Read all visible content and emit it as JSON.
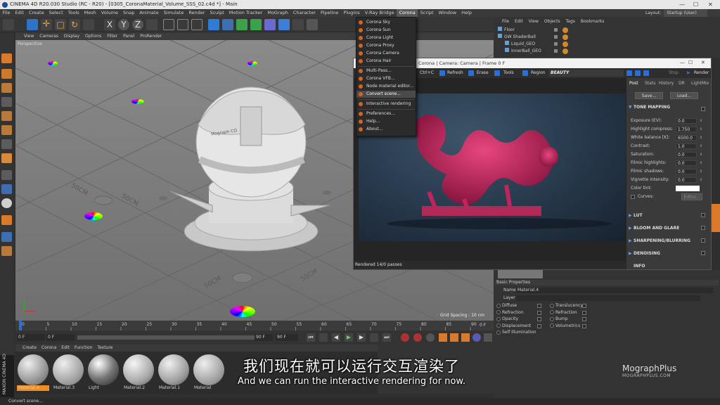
{
  "window": {
    "title": "CINEMA 4D R20.030 Studio (RC - R20) - [0305_CoronaMaterial_Volume_SSS_02.c4d *] - Main",
    "minimize": "—",
    "maximize": "☐",
    "close": "✕"
  },
  "menubar": {
    "items": [
      "File",
      "Edit",
      "Create",
      "Select",
      "Tools",
      "Mesh",
      "Volume",
      "Snap",
      "Animate",
      "Simulate",
      "Render",
      "Sculpt",
      "Motion Tracker",
      "MoGraph",
      "Character",
      "Pipeline",
      "Plugins",
      "V-Ray Bridge",
      "Corona",
      "Script",
      "Window",
      "Help"
    ],
    "active": "Corona",
    "layout_label": "Layout:",
    "layout_value": "Startup (User)"
  },
  "corona_menu": {
    "items": [
      {
        "label": "Corona Sky"
      },
      {
        "label": "Corona Sun"
      },
      {
        "label": "Corona Light"
      },
      {
        "label": "Corona Proxy"
      },
      {
        "label": "Corona Camera"
      },
      {
        "label": "Corona Hair"
      },
      {
        "label": "Multi-Pass..."
      },
      {
        "label": "Corona VFB..."
      },
      {
        "label": "Node material editor..."
      },
      {
        "label": "Convert scene..."
      },
      {
        "label": "Interactive rendering"
      },
      {
        "label": "Preferences..."
      },
      {
        "label": "Help..."
      },
      {
        "label": "About..."
      }
    ],
    "highlighted": "Convert scene..."
  },
  "viewport": {
    "menu": [
      "View",
      "Cameras",
      "Display",
      "Options",
      "Filter",
      "Panel",
      "ProRender"
    ],
    "label": "Perspective",
    "grid_spacing": "Grid Spacing : 10 cm",
    "floor_labels": [
      "50CM",
      "50CM",
      "50CM",
      "50CM"
    ],
    "sphere_text": "Mograph CO"
  },
  "timeline": {
    "ticks": [
      "0",
      "5",
      "10",
      "15",
      "20",
      "25",
      "30",
      "35",
      "40",
      "45",
      "50",
      "55",
      "60",
      "65",
      "70",
      "75",
      "80",
      "85",
      "90"
    ],
    "end_label": "0 F",
    "start_field": "0 F",
    "min_field": "0 F",
    "max_field": "90 F",
    "end_field": "90 F"
  },
  "object_manager": {
    "menu": [
      "File",
      "Edit",
      "View",
      "Objects",
      "Tags",
      "Bookmarks"
    ],
    "rows": [
      "Floor",
      "GW ShaderBall",
      "Liquid_GEO",
      "InnerBall_GEO"
    ]
  },
  "vfb": {
    "title": "Corona | Camera: Camera | Frame 0 F",
    "toolbar": {
      "copy": "Ctrl+C",
      "refresh": "Refresh",
      "erase": "Erase",
      "tools": "Tools",
      "region": "Region",
      "pass": "BEAUTY",
      "stop": "Stop",
      "render": "Render"
    },
    "status": "Rendered 14/0 passes",
    "tabs": [
      "Post",
      "Stats",
      "History",
      "DR",
      "LightMix"
    ],
    "save": "Save...",
    "load": "Load...",
    "tone_mapping": "TONE MAPPING",
    "params": [
      {
        "label": "Exposure (EV):",
        "value": "0.0"
      },
      {
        "label": "Highlight compress:",
        "value": "1.750"
      },
      {
        "label": "White balance [K]:",
        "value": "6500.0"
      },
      {
        "label": "Contrast:",
        "value": "1.0"
      },
      {
        "label": "Saturation:",
        "value": "0.0"
      },
      {
        "label": "Filmic highlights:",
        "value": "0.0"
      },
      {
        "label": "Filmic shadows:",
        "value": "0.0"
      },
      {
        "label": "Vignette intensity:",
        "value": "0.0"
      }
    ],
    "color_tint": "Color tint:",
    "curves": "Curves:",
    "curves_btn": "Editor...",
    "sections": [
      "LUT",
      "BLOOM AND GLARE",
      "SHARPENING/BLURRING",
      "DENOISING",
      "INFO"
    ]
  },
  "attributes": {
    "header": "Basic Properties",
    "name_label": "Name",
    "name_value": "Material.4",
    "layer_label": "Layer",
    "left_channels": [
      "Diffuse",
      "Refraction",
      "Opacity",
      "Displacement",
      "Self Illumination"
    ],
    "right_channels": [
      "Translucency",
      "Refraction",
      "Bump",
      "Volumetrics"
    ]
  },
  "material_manager": {
    "menu": [
      "Create",
      "Corona",
      "Edit",
      "Function",
      "Texture"
    ],
    "materials": [
      "Material.4",
      "Material.3",
      "Light",
      "Material.2",
      "Material.1",
      "Material"
    ]
  },
  "status_bar": "Convert scene...",
  "subtitle": {
    "cn": "我们现在就可以运行交互渲染了",
    "en": "And we can run the interactive rendering for now."
  },
  "brand": {
    "name": "MographPlus",
    "url": "MOGRAPHPLUS.COM",
    "vertical": "MAXON CINEMA 4D"
  },
  "colors": {
    "accent": "#2a6fd8",
    "corona_orange": "#d2641e",
    "dragon": "#c0245a",
    "active_frame": "#f28c1e"
  }
}
